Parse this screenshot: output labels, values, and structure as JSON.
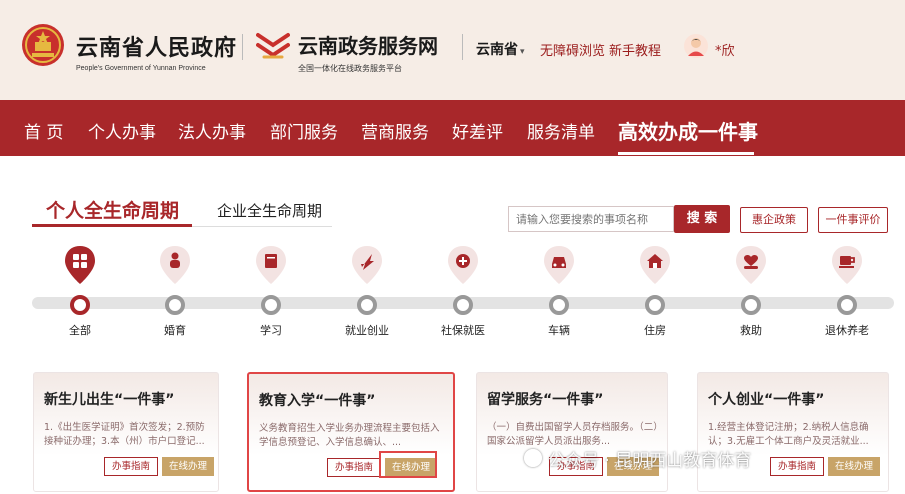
{
  "header": {
    "site_title": "云南省人民政府",
    "site_subtitle": "People's Government of Yunnan Province",
    "service_title": "云南政务服务网",
    "service_subtitle": "全国一体化在线政务服务平台",
    "region": "云南省",
    "region_caret": "▾",
    "links": {
      "accessibility": "无障碍浏览",
      "tutorial": "新手教程"
    },
    "user": "*欣"
  },
  "nav": {
    "items": [
      "首 页",
      "个人办事",
      "法人办事",
      "部门服务",
      "营商服务",
      "好差评",
      "服务清单",
      "高效办成一件事"
    ],
    "active_index": 7
  },
  "tabs": {
    "personal": "个人全生命周期",
    "enterprise": "企业全生命周期"
  },
  "search": {
    "placeholder": "请输入您要搜索的事项名称",
    "button": "搜 索",
    "policy_button": "惠企政策",
    "rating_button": "一件事评价"
  },
  "categories": [
    {
      "label": "全部",
      "icon": "grid-icon",
      "active": true
    },
    {
      "label": "婚育",
      "icon": "baby-icon",
      "active": false
    },
    {
      "label": "学习",
      "icon": "book-icon",
      "active": false
    },
    {
      "label": "就业创业",
      "icon": "rocket-icon",
      "active": false
    },
    {
      "label": "社保就医",
      "icon": "medical-cross-icon",
      "active": false
    },
    {
      "label": "车辆",
      "icon": "car-icon",
      "active": false
    },
    {
      "label": "住房",
      "icon": "house-icon",
      "active": false
    },
    {
      "label": "救助",
      "icon": "heart-hand-icon",
      "active": false
    },
    {
      "label": "退休养老",
      "icon": "teacup-icon",
      "active": false
    }
  ],
  "cards": [
    {
      "title": "新生儿出生“一件事”",
      "desc": "1.《出生医学证明》首次签发；2.预防接种证办理；3.本（州）市户口登记...",
      "guide": "办事指南",
      "online": "在线办理",
      "highlighted": false
    },
    {
      "title": "教育入学“一件事”",
      "desc": "义务教育招生入学业务办理流程主要包括入学信息预登记、入学信息确认、...",
      "guide": "办事指南",
      "online": "在线办理",
      "highlighted": true
    },
    {
      "title": "留学服务“一件事”",
      "desc": "（一）自费出国留学人员存档服务。（二）国家公派留学人员派出服务...",
      "guide": "办事指南",
      "online": "在线办理",
      "highlighted": false
    },
    {
      "title": "个人创业“一件事”",
      "desc": "1.经营主体登记注册；2.纳税人信息确认；3.无雇工个体工商户及灵活就业...",
      "guide": "办事指南",
      "online": "在线办理",
      "highlighted": false
    }
  ],
  "watermark": "公众号 · 昆明西山教育体育",
  "colors": {
    "brand_red": "#a8272a",
    "header_bg": "#f6ede6",
    "online_gold": "#c8a468",
    "highlight_red": "#e04646"
  }
}
